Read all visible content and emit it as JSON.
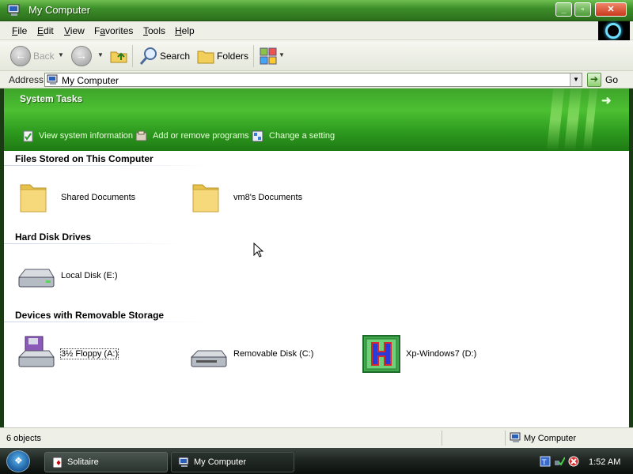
{
  "window": {
    "title": "My Computer",
    "controls": {
      "minimize": "_",
      "maximize": "▫",
      "close": "✕"
    }
  },
  "menubar": {
    "items": [
      {
        "label": "File",
        "underline_index": 0
      },
      {
        "label": "Edit",
        "underline_index": 0
      },
      {
        "label": "View",
        "underline_index": 0
      },
      {
        "label": "Favorites",
        "underline_index": 1
      },
      {
        "label": "Tools",
        "underline_index": 0
      },
      {
        "label": "Help",
        "underline_index": 0
      }
    ]
  },
  "toolbar": {
    "back_label": "Back",
    "search_label": "Search",
    "folders_label": "Folders"
  },
  "address": {
    "label": "Address",
    "value": "My Computer",
    "go_label": "Go"
  },
  "system_tasks": {
    "title": "System Tasks",
    "links": [
      "View system information",
      "Add or remove programs",
      "Change a setting"
    ]
  },
  "groups": [
    {
      "header": "Files Stored on This Computer",
      "items": [
        {
          "label": "Shared Documents",
          "icon": "folder-icon"
        },
        {
          "label": "vm8's Documents",
          "icon": "folder-icon"
        }
      ]
    },
    {
      "header": "Hard Disk Drives",
      "items": [
        {
          "label": "Local Disk (E:)",
          "icon": "hard-disk-icon"
        }
      ]
    },
    {
      "header": "Devices with Removable Storage",
      "items": [
        {
          "label": "3½ Floppy (A:)",
          "icon": "floppy-drive-icon",
          "selected": true
        },
        {
          "label": "Removable Disk (C:)",
          "icon": "removable-disk-icon"
        },
        {
          "label": "Xp-Windows7 (D:)",
          "icon": "cd-drive-custom-icon"
        }
      ]
    }
  ],
  "statusbar": {
    "count": "6 objects",
    "location": "My Computer"
  },
  "taskbar": {
    "buttons": [
      {
        "label": "Solitaire",
        "icon": "solitaire-icon",
        "active": false
      },
      {
        "label": "My Computer",
        "icon": "my-computer-icon",
        "active": true
      }
    ],
    "clock": "1:52 AM"
  },
  "colors": {
    "title_green": "#3d8f2a",
    "tasks_green": "#4cc032",
    "content_bg": "#ffffff",
    "taskbar_dark": "#1f2622"
  }
}
